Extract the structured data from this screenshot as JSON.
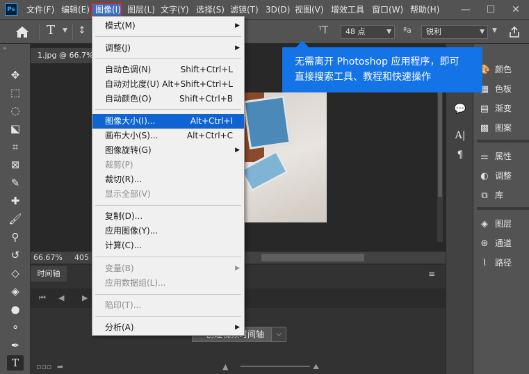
{
  "app": {
    "logo": "Ps"
  },
  "menubar": {
    "items": [
      "文件(F)",
      "编辑(E)",
      "图像(I)",
      "图层(L)",
      "文字(Y)",
      "选择(S)",
      "滤镜(T)",
      "3D(D)",
      "视图(V)",
      "增效工具",
      "窗口(W)",
      "帮助(H)"
    ],
    "active_index": 2,
    "window_controls": [
      "minimize-icon",
      "maximize-icon",
      "close-icon"
    ]
  },
  "optionsbar": {
    "font_size": "48 点",
    "antialias": "锐利",
    "icons": [
      "home-icon",
      "text-tool-icon",
      "text-orientation-icon",
      "font-size-icon",
      "antialias-icon",
      "share-icon"
    ]
  },
  "document": {
    "tab_label": "1.jpg @ 66.7%",
    "zoom": "66.67%",
    "status": "405"
  },
  "timeline": {
    "tab_label": "时间轴",
    "create_label": "创建视频时间轴"
  },
  "rightpanel": {
    "items": [
      {
        "label": "颜色",
        "icon": "color-icon"
      },
      {
        "label": "色板",
        "icon": "swatches-icon"
      },
      {
        "label": "渐变",
        "icon": "gradient-icon"
      },
      {
        "label": "图案",
        "icon": "pattern-icon"
      },
      {
        "label": "属性",
        "icon": "properties-icon"
      },
      {
        "label": "调整",
        "icon": "adjustments-icon"
      },
      {
        "label": "库",
        "icon": "libraries-icon"
      },
      {
        "label": "图层",
        "icon": "layers-icon"
      },
      {
        "label": "通道",
        "icon": "channels-icon"
      },
      {
        "label": "路径",
        "icon": "paths-icon"
      }
    ]
  },
  "image_menu": {
    "items": [
      {
        "label": "模式(M)",
        "shortcut": "",
        "submenu": true,
        "disabled": false,
        "highlight": false
      },
      {
        "label": "调整(J)",
        "shortcut": "",
        "submenu": true,
        "disabled": false,
        "highlight": false
      },
      {
        "label": "自动色调(N)",
        "shortcut": "Shift+Ctrl+L",
        "submenu": false,
        "disabled": false,
        "highlight": false
      },
      {
        "label": "自动对比度(U)",
        "shortcut": "Alt+Shift+Ctrl+L",
        "submenu": false,
        "disabled": false,
        "highlight": false
      },
      {
        "label": "自动颜色(O)",
        "shortcut": "Shift+Ctrl+B",
        "submenu": false,
        "disabled": false,
        "highlight": false
      },
      {
        "label": "图像大小(I)...",
        "shortcut": "Alt+Ctrl+I",
        "submenu": false,
        "disabled": false,
        "highlight": true
      },
      {
        "label": "画布大小(S)...",
        "shortcut": "Alt+Ctrl+C",
        "submenu": false,
        "disabled": false,
        "highlight": false
      },
      {
        "label": "图像旋转(G)",
        "shortcut": "",
        "submenu": true,
        "disabled": false,
        "highlight": false
      },
      {
        "label": "裁剪(P)",
        "shortcut": "",
        "submenu": false,
        "disabled": true,
        "highlight": false
      },
      {
        "label": "裁切(R)...",
        "shortcut": "",
        "submenu": false,
        "disabled": false,
        "highlight": false
      },
      {
        "label": "显示全部(V)",
        "shortcut": "",
        "submenu": false,
        "disabled": true,
        "highlight": false
      },
      {
        "label": "复制(D)...",
        "shortcut": "",
        "submenu": false,
        "disabled": false,
        "highlight": false
      },
      {
        "label": "应用图像(Y)...",
        "shortcut": "",
        "submenu": false,
        "disabled": false,
        "highlight": false
      },
      {
        "label": "计算(C)...",
        "shortcut": "",
        "submenu": false,
        "disabled": false,
        "highlight": false
      },
      {
        "label": "变量(B)",
        "shortcut": "",
        "submenu": true,
        "disabled": true,
        "highlight": false
      },
      {
        "label": "应用数据组(L)...",
        "shortcut": "",
        "submenu": false,
        "disabled": true,
        "highlight": false
      },
      {
        "label": "陷印(T)...",
        "shortcut": "",
        "submenu": false,
        "disabled": true,
        "highlight": false
      },
      {
        "label": "分析(A)",
        "shortcut": "",
        "submenu": true,
        "disabled": false,
        "highlight": false
      }
    ]
  },
  "callout": {
    "line1": "无需离开 Photoshop 应用程序，即可",
    "line2": "直接搜索工具、教程和快速操作"
  },
  "colors": {
    "accent": "#1473e6",
    "menu_highlight": "#0f64d2",
    "active_outline": "#e02020"
  }
}
